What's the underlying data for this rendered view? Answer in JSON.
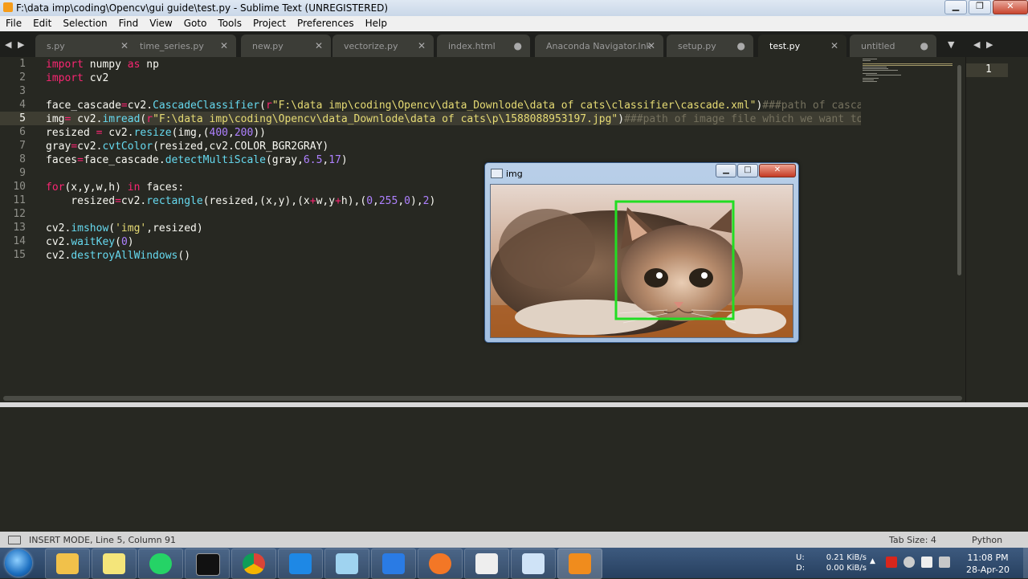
{
  "window": {
    "title": "F:\\data imp\\coding\\Opencv\\gui guide\\test.py - Sublime Text (UNREGISTERED)",
    "controls": {
      "minimize": "▁",
      "maximize": "❐",
      "close": "✕"
    }
  },
  "menu": [
    "File",
    "Edit",
    "Selection",
    "Find",
    "View",
    "Goto",
    "Tools",
    "Project",
    "Preferences",
    "Help"
  ],
  "tabs": [
    {
      "label": "s.py",
      "close": "✕",
      "active": false
    },
    {
      "label": "time_series.py",
      "close": "✕",
      "active": false
    },
    {
      "label": "new.py",
      "close": "✕",
      "active": false
    },
    {
      "label": "vectorize.py",
      "close": "✕",
      "active": false
    },
    {
      "label": "index.html",
      "close": "●",
      "active": false
    },
    {
      "label": "Anaconda Navigator.lnk",
      "close": "✕",
      "active": false
    },
    {
      "label": "setup.py",
      "close": "●",
      "active": false
    },
    {
      "label": "test.py",
      "close": "✕",
      "active": true
    },
    {
      "label": "untitled",
      "close": "●",
      "active": false
    }
  ],
  "tab_nav": {
    "left": "◀ ▶",
    "dropdown": "▼",
    "right": "◀ ▶"
  },
  "editor": {
    "current_line": 5,
    "line_numbers": [
      "1",
      "2",
      "3",
      "4",
      "5",
      "6",
      "7",
      "8",
      "9",
      "10",
      "11",
      "12",
      "13",
      "14",
      "15"
    ]
  },
  "second_pane": {
    "line_number": "1"
  },
  "image_window": {
    "title": "img",
    "controls": {
      "minimize": "▁",
      "maximize": "□",
      "close": "✕"
    },
    "detection_box_color": "#22dd22"
  },
  "status": {
    "left": "INSERT MODE, Line 5, Column 91",
    "tab_size": "Tab Size: 4",
    "syntax": "Python"
  },
  "taskbar": {
    "apps": [
      "file-explorer",
      "sticky-notes",
      "whatsapp",
      "command-prompt",
      "chrome",
      "vscode",
      "notepad",
      "wps-writer",
      "jupyter",
      "anaconda",
      "paint",
      "sublime-text"
    ],
    "tray": {
      "upload_label": "U:",
      "download_label": "D:",
      "upload_rate": "0.21 KiB/s",
      "download_rate": "0.00 KiB/s",
      "time": "11:08 PM",
      "date": "28-Apr-20"
    }
  },
  "colors": {
    "editor_bg": "#272822",
    "keyword": "#f92672",
    "function": "#66d9ef",
    "string": "#e6db74",
    "number": "#ae81ff",
    "comment": "#75715e"
  }
}
